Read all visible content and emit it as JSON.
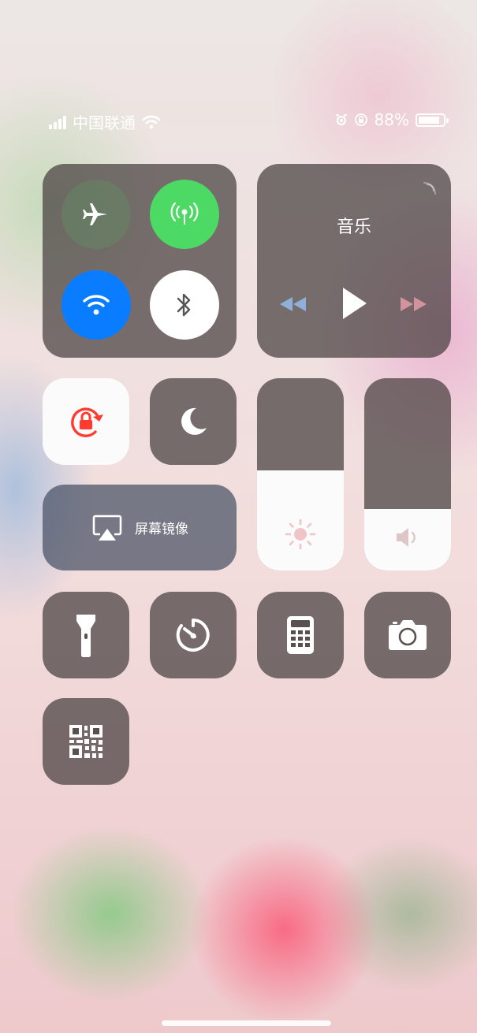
{
  "status_bar": {
    "carrier": "中国联通",
    "battery_percent": "88%",
    "battery_level": 0.88,
    "left_icons": [
      "signal-bars-icon",
      "wifi-icon"
    ],
    "right_icons": [
      "alarm-icon",
      "orientation-lock-icon",
      "battery-icon"
    ]
  },
  "connectivity": {
    "airplane_mode": {
      "icon": "airplane-icon",
      "state": "off"
    },
    "cellular_data": {
      "icon": "antenna-icon",
      "state": "on",
      "color": "#4cd964"
    },
    "wifi": {
      "icon": "wifi-icon",
      "state": "on",
      "color": "#0a7cff"
    },
    "bluetooth": {
      "icon": "bluetooth-icon",
      "state": "off"
    }
  },
  "music": {
    "title": "音乐",
    "controls": [
      "rewind-icon",
      "play-icon",
      "fast-forward-icon"
    ],
    "airplay_icon": "airplay-icon"
  },
  "toggles": {
    "orientation_lock": {
      "icon": "orientation-lock-icon",
      "state": "on",
      "color": "#ff3b30"
    },
    "do_not_disturb": {
      "icon": "moon-icon",
      "state": "off"
    }
  },
  "screen_mirroring": {
    "label": "屏幕镜像",
    "icon": "airplay-screen-icon"
  },
  "brightness": {
    "icon": "sun-icon",
    "level": 0.52
  },
  "volume": {
    "icon": "speaker-icon",
    "level": 0.32
  },
  "shortcuts": [
    {
      "name": "flashlight",
      "icon": "flashlight-icon"
    },
    {
      "name": "timer",
      "icon": "timer-icon"
    },
    {
      "name": "calculator",
      "icon": "calculator-icon"
    },
    {
      "name": "camera",
      "icon": "camera-icon"
    },
    {
      "name": "qr-code-scanner",
      "icon": "qr-code-icon"
    }
  ]
}
